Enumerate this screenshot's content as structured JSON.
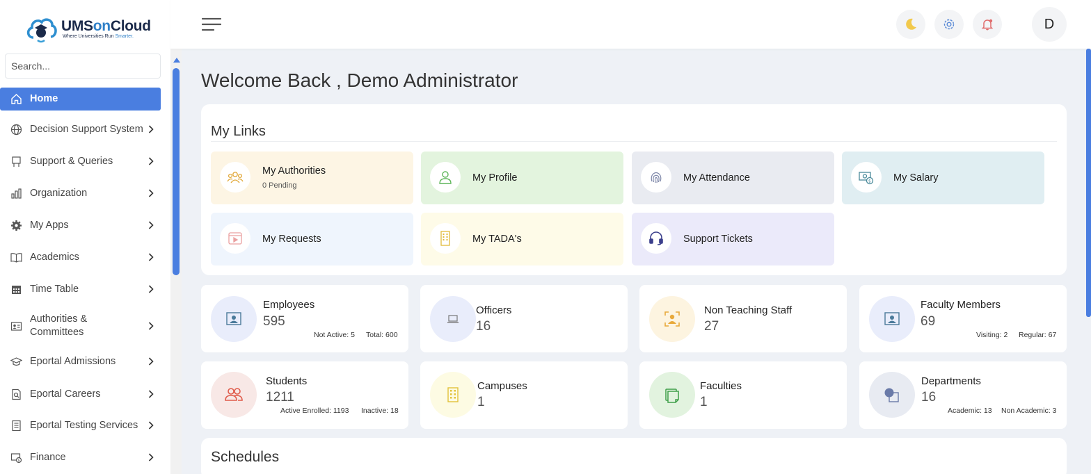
{
  "brand": {
    "name_a": "UMS",
    "name_b": "on",
    "name_c": "Cloud",
    "tagline_a": "Where Universities Run ",
    "tagline_b": "Smarter."
  },
  "search": {
    "placeholder": "Search..."
  },
  "sidebar": {
    "items": [
      {
        "label": "Home",
        "icon": "home-icon",
        "active": true
      },
      {
        "label": "Decision Support System",
        "icon": "globe-icon"
      },
      {
        "label": "Support & Queries",
        "icon": "book-stand-icon"
      },
      {
        "label": "Organization",
        "icon": "building-chart-icon"
      },
      {
        "label": "My Apps",
        "icon": "gear-icon"
      },
      {
        "label": "Academics",
        "icon": "open-book-icon"
      },
      {
        "label": "Time Table",
        "icon": "calendar-icon"
      },
      {
        "label": "Authorities & Committees",
        "icon": "id-card-icon"
      },
      {
        "label": "Eportal Admissions",
        "icon": "graduation-cap-icon"
      },
      {
        "label": "Eportal Careers",
        "icon": "document-search-icon"
      },
      {
        "label": "Eportal Testing Services",
        "icon": "document-list-icon"
      },
      {
        "label": "Finance",
        "icon": "money-icon"
      }
    ]
  },
  "header": {
    "avatar_initial": "D",
    "icons": [
      "menu-icon",
      "moon-icon",
      "settings-icon",
      "notification-bell-icon"
    ]
  },
  "main": {
    "welcome": "Welcome Back , Demo Administrator",
    "my_links": {
      "title": "My Links",
      "items": [
        {
          "label": "My Authorities",
          "sub": "0 Pending",
          "icon": "people-group-icon",
          "bg": "#fdf5e4"
        },
        {
          "label": "My Profile",
          "icon": "user-icon",
          "bg": "#e3f4de"
        },
        {
          "label": "My Attendance",
          "icon": "fingerprint-icon",
          "bg": "#e9ebf1"
        },
        {
          "label": "My Salary",
          "icon": "salary-icon",
          "bg": "#e0eef2"
        },
        {
          "label": "My Requests",
          "icon": "request-icon",
          "bg": "#eff5fd"
        },
        {
          "label": "My TADA's",
          "icon": "building-icon",
          "bg": "#fefbe8"
        },
        {
          "label": "Support Tickets",
          "icon": "headset-icon",
          "bg": "#ebeafa"
        }
      ]
    },
    "stats": [
      {
        "label": "Employees",
        "value": "595",
        "sub1": "Not Active: 5",
        "sub2": "Total: 600",
        "icon": "employee-badge-icon",
        "circle": "#e9edfb"
      },
      {
        "label": "Officers",
        "value": "16",
        "icon": "laptop-icon",
        "circle": "#e9edfb"
      },
      {
        "label": "Non Teaching Staff",
        "value": "27",
        "icon": "staff-scan-icon",
        "circle": "#fdf4e0"
      },
      {
        "label": "Faculty Members",
        "value": "69",
        "sub1": "Visiting: 2",
        "sub2": "Regular: 67",
        "icon": "faculty-badge-icon",
        "circle": "#e9edfb"
      },
      {
        "label": "Students",
        "value": "1211",
        "sub1": "Active Enrolled: 1193",
        "sub2": "Inactive: 18",
        "icon": "students-icon",
        "circle": "#f8e8e6"
      },
      {
        "label": "Campuses",
        "value": "1",
        "icon": "campus-building-icon",
        "circle": "#fdfbe3"
      },
      {
        "label": "Faculties",
        "value": "1",
        "icon": "faculties-icon",
        "circle": "#e2f3df"
      },
      {
        "label": "Departments",
        "value": "16",
        "sub1": "Academic: 13",
        "sub2": "Non Academic: 3",
        "icon": "departments-icon",
        "circle": "#e8ebf2"
      }
    ],
    "schedules_title": "Schedules"
  },
  "colors": {
    "accent": "#4a7ee0",
    "background": "#eef1f6"
  }
}
